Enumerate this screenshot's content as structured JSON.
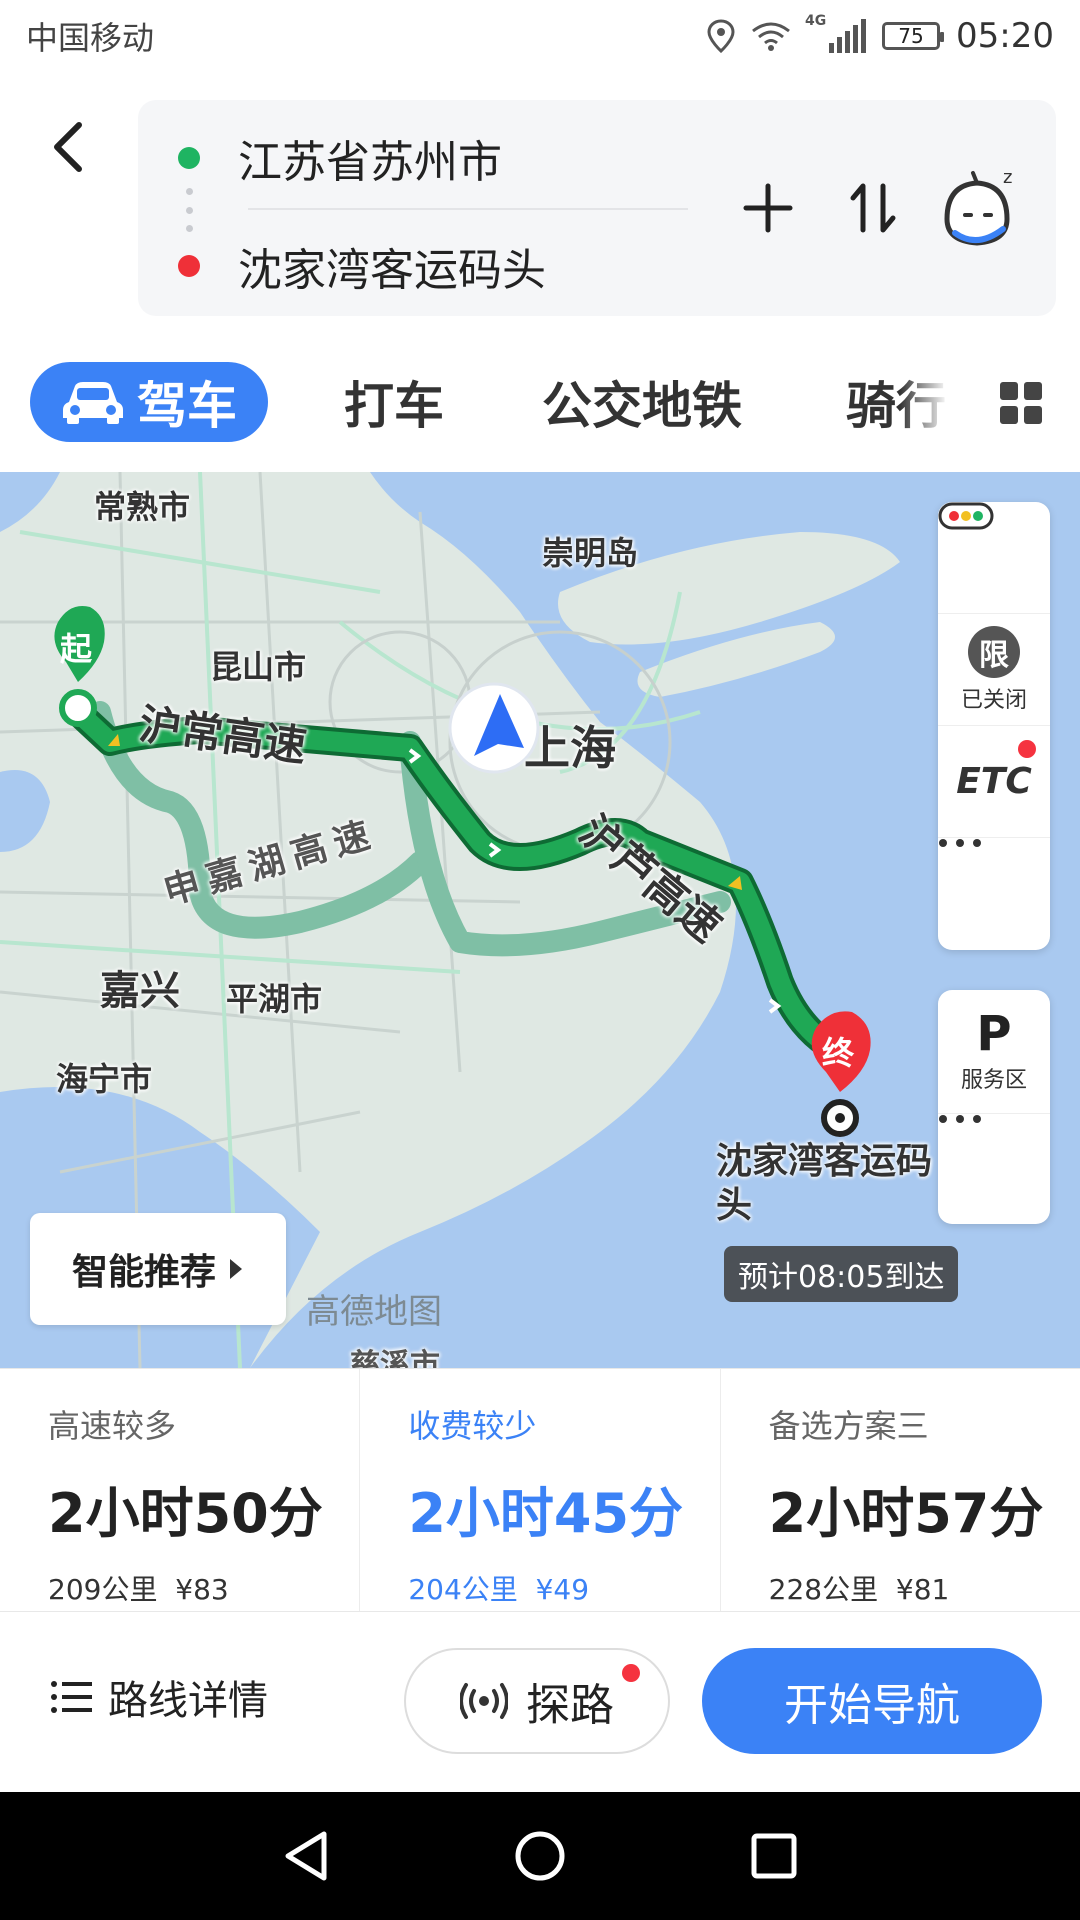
{
  "status_bar": {
    "carrier": "中国移动",
    "network": "4G",
    "battery": "75",
    "time": "05:20"
  },
  "route": {
    "origin": "江苏省苏州市",
    "destination": "沈家湾客运码头"
  },
  "tabs": [
    {
      "label": "驾车",
      "active": true
    },
    {
      "label": "打车",
      "active": false
    },
    {
      "label": "公交地铁",
      "active": false
    },
    {
      "label": "骑行",
      "active": false
    }
  ],
  "map": {
    "labels": {
      "changshu": "常熟市",
      "chongming": "崇明岛",
      "kunshan": "昆山市",
      "shanghai": "上海",
      "jiaxing": "嘉兴",
      "pinghu": "平湖市",
      "haining": "海宁市",
      "partial_bottom": "慈溪市",
      "dest_label": "沈家湾客运码头"
    },
    "road_labels": {
      "huchang": "沪常高速",
      "shenjiahu": "申嘉湖高速",
      "huluo": "沪芦高速"
    },
    "start_marker": "起",
    "end_marker": "终",
    "eta": "预计08:05到达",
    "watermark": "高德地图",
    "smart_recommend": "智能推荐",
    "side_panel": {
      "restriction_label": "已关闭",
      "restriction_icon": "限",
      "etc": "ETC",
      "service_area_label": "服务区",
      "service_area_icon": "P"
    }
  },
  "options": [
    {
      "title": "高速较多",
      "time": "2小时50分",
      "distance": "209公里",
      "fee": "¥83",
      "selected": false
    },
    {
      "title": "收费较少",
      "time": "2小时45分",
      "distance": "204公里",
      "fee": "¥49",
      "selected": true
    },
    {
      "title": "备选方案三",
      "time": "2小时57分",
      "distance": "228公里",
      "fee": "¥81",
      "selected": false
    }
  ],
  "actions": {
    "route_detail": "路线详情",
    "probe": "探路",
    "start_nav": "开始导航"
  },
  "colors": {
    "accent": "#3b82f6",
    "route_main": "#1fa855",
    "route_alt": "#7fbfa5",
    "water": "#a9c9f0",
    "alert": "#f5333f"
  }
}
